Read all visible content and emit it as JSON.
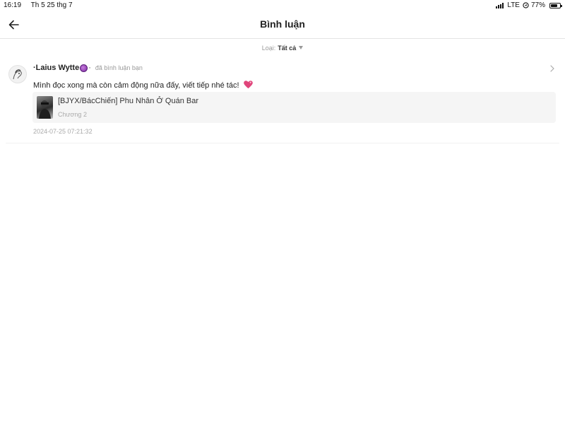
{
  "status_bar": {
    "time": "16:19",
    "date": "Th 5 25 thg 7",
    "network": "LTE",
    "battery": "77%",
    "battery_level": 0.77,
    "icons": [
      "signal-icon",
      "location-icon",
      "battery-icon"
    ]
  },
  "header": {
    "title": "Bình luận",
    "back_icon": "arrow-left-icon"
  },
  "filter": {
    "label": "Loại:",
    "value": "Tất cả"
  },
  "comments": [
    {
      "username": "·Laius Wytte",
      "badge_icon": "purple-crystal-ball-icon",
      "separator": "·",
      "action": "đã bình luận bạn",
      "text": "Mình đọc xong mà còn cảm động nữa đấy, viết tiếp nhé tác!",
      "emoji_icon": "sparkling-heart-icon",
      "story": {
        "title": "[BJYX/BácChiến] Phu Nhân Ở Quán Bar",
        "chapter": "Chương 2"
      },
      "timestamp": "2024-07-25 07:21:32"
    }
  ],
  "colors": {
    "background": "#ffffff",
    "card_background": "#f5f5f5",
    "muted_text": "#aaaaaa",
    "heart": "#e0457b"
  }
}
